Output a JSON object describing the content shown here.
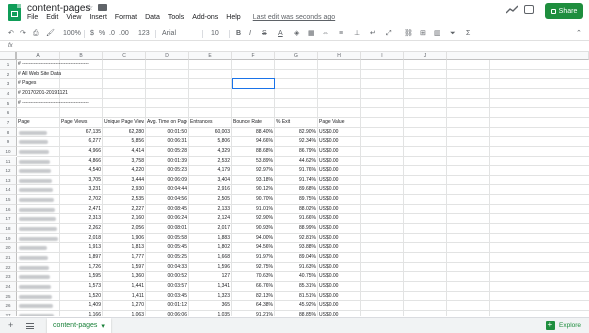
{
  "title": "content-pages",
  "menu": [
    "File",
    "Edit",
    "View",
    "Insert",
    "Format",
    "Data",
    "Tools",
    "Add-ons",
    "Help"
  ],
  "last_edit": "Last edit was seconds ago",
  "share_label": "Share",
  "toolbar": {
    "zoom": "100%",
    "currency": "$",
    "percent": "%",
    "dec_less": ".0",
    "dec_more": ".00",
    "format_more": "123",
    "font": "Arial",
    "font_size": "10",
    "bold": "B",
    "italic": "I",
    "strike": "S",
    "text_color": "A",
    "sigma": "Σ"
  },
  "formula_bar": {
    "fx": "fx"
  },
  "columns": [
    "A",
    "B",
    "C",
    "D",
    "E",
    "F",
    "G",
    "H",
    "I",
    "J"
  ],
  "rows": [
    "1",
    "2",
    "3",
    "4",
    "5",
    "6",
    "7",
    "8",
    "9",
    "10",
    "11",
    "12",
    "13",
    "14",
    "15",
    "16",
    "17",
    "18",
    "19",
    "20",
    "21",
    "22",
    "23",
    "24",
    "25",
    "26",
    "27"
  ],
  "header_comments": [
    "# ----------------------------------------",
    "# All Web Site Data",
    "# Pages",
    "# 20170201-20191121",
    "# ----------------------------------------"
  ],
  "table_headers": [
    "Page",
    "Page Views",
    "Unique Page Views",
    "Avg. Time on Page",
    "Entrances",
    "Bounce Rate",
    "% Exit",
    "Page Value"
  ],
  "table_rows": [
    [
      "67,135",
      "62,280",
      "00:01:50",
      "60,003",
      "88.40%",
      "82.90%",
      "US$0.00"
    ],
    [
      "6,277",
      "5,856",
      "00:06:31",
      "5,806",
      "94.66%",
      "92.34%",
      "US$0.00"
    ],
    [
      "4,966",
      "4,414",
      "00:05:28",
      "4,329",
      "88.68%",
      "86.79%",
      "US$0.00"
    ],
    [
      "4,866",
      "3,758",
      "00:01:39",
      "2,532",
      "53.89%",
      "44.62%",
      "US$0.00"
    ],
    [
      "4,540",
      "4,220",
      "00:05:23",
      "4,179",
      "92.97%",
      "91.76%",
      "US$0.00"
    ],
    [
      "3,705",
      "3,444",
      "00:06:09",
      "3,404",
      "93.18%",
      "91.74%",
      "US$0.00"
    ],
    [
      "3,231",
      "2,930",
      "00:04:44",
      "2,916",
      "90.12%",
      "89.68%",
      "US$0.00"
    ],
    [
      "2,702",
      "2,535",
      "00:04:56",
      "2,505",
      "90.70%",
      "89.75%",
      "US$0.00"
    ],
    [
      "2,471",
      "2,227",
      "00:08:45",
      "2,133",
      "91.01%",
      "88.02%",
      "US$0.00"
    ],
    [
      "2,313",
      "2,160",
      "00:06:24",
      "2,124",
      "92.90%",
      "91.66%",
      "US$0.00"
    ],
    [
      "2,262",
      "2,056",
      "00:08:01",
      "2,017",
      "90.93%",
      "88.99%",
      "US$0.00"
    ],
    [
      "2,018",
      "1,906",
      "00:05:58",
      "1,883",
      "94.00%",
      "92.81%",
      "US$0.00"
    ],
    [
      "1,913",
      "1,813",
      "00:05:45",
      "1,802",
      "94.56%",
      "93.88%",
      "US$0.00"
    ],
    [
      "1,897",
      "1,777",
      "00:05:25",
      "1,668",
      "91.97%",
      "89.04%",
      "US$0.00"
    ],
    [
      "1,726",
      "1,597",
      "00:04:33",
      "1,596",
      "92.75%",
      "91.63%",
      "US$0.00"
    ],
    [
      "1,595",
      "1,360",
      "00:00:52",
      "127",
      "70.63%",
      "40.75%",
      "US$0.00"
    ],
    [
      "1,573",
      "1,441",
      "00:03:57",
      "1,341",
      "66.76%",
      "85.31%",
      "US$0.00"
    ],
    [
      "1,520",
      "1,411",
      "00:03:45",
      "1,323",
      "82.13%",
      "81.51%",
      "US$0.00"
    ],
    [
      "1,409",
      "1,270",
      "00:01:12",
      "365",
      "64.38%",
      "45.92%",
      "US$0.00"
    ],
    [
      "1,166",
      "1,063",
      "00:06:06",
      "1,035",
      "91.21%",
      "88.85%",
      "US$0.00"
    ],
    [
      "1,158",
      "1,104",
      "00:07:38",
      "1,098",
      "94.58%",
      "93.70%",
      "US$0.00"
    ]
  ],
  "sheet_tab": "content-pages",
  "explore_label": "Explore"
}
